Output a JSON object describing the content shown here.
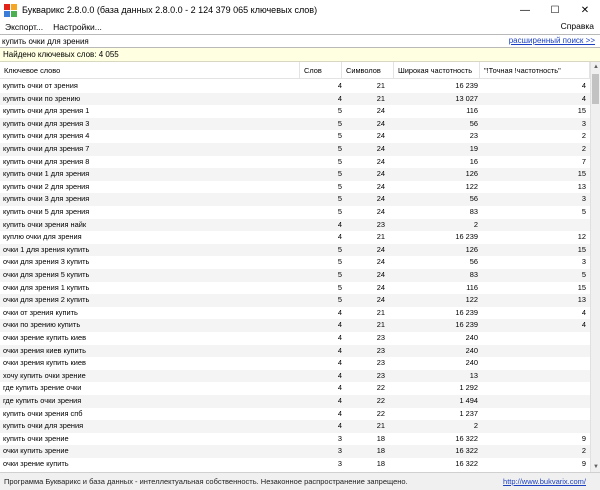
{
  "window": {
    "title": "Букварикс 2.8.0.0 (база данных 2.8.0.0 - 2 124 379 065 ключевых слов)",
    "controls": {
      "minimize": "—",
      "maximize": "☐",
      "close": "✕"
    }
  },
  "menu": {
    "items": [
      "Экспорт...",
      "Настройки..."
    ],
    "help": "Справка"
  },
  "search": {
    "value": "купить очки для зрения",
    "advanced_link": "расширенный поиск >>"
  },
  "found": "Найдено ключевых слов: 4 055",
  "table": {
    "columns": [
      "Ключевое слово",
      "Слов",
      "Символов",
      "Широкая частотность",
      "\"!Точная !частотность\""
    ],
    "rows": [
      [
        "купить очки от зрения",
        "4",
        "21",
        "16 239",
        "4"
      ],
      [
        "купить очки по зрению",
        "4",
        "21",
        "13 027",
        "4"
      ],
      [
        "купить очки для зрения 1",
        "5",
        "24",
        "116",
        "15"
      ],
      [
        "купить очки для зрения 3",
        "5",
        "24",
        "56",
        "3"
      ],
      [
        "купить очки для зрения 4",
        "5",
        "24",
        "23",
        "2"
      ],
      [
        "купить очки для зрения 7",
        "5",
        "24",
        "19",
        "2"
      ],
      [
        "купить очки для зрения 8",
        "5",
        "24",
        "16",
        "7"
      ],
      [
        "купить очки 1 для зрения",
        "5",
        "24",
        "126",
        "15"
      ],
      [
        "купить очки 2 для зрения",
        "5",
        "24",
        "122",
        "13"
      ],
      [
        "купить очки 3 для зрения",
        "5",
        "24",
        "56",
        "3"
      ],
      [
        "купить очки 5 для зрения",
        "5",
        "24",
        "83",
        "5"
      ],
      [
        "купить очки зрения найк",
        "4",
        "23",
        "2",
        ""
      ],
      [
        "куплю очки для зрения",
        "4",
        "21",
        "16 239",
        "12"
      ],
      [
        "очки 1 для зрения купить",
        "5",
        "24",
        "126",
        "15"
      ],
      [
        "очки для зрения 3 купить",
        "5",
        "24",
        "56",
        "3"
      ],
      [
        "очки для зрения 5 купить",
        "5",
        "24",
        "83",
        "5"
      ],
      [
        "очки для зрения 1 купить",
        "5",
        "24",
        "116",
        "15"
      ],
      [
        "очки для зрения 2 купить",
        "5",
        "24",
        "122",
        "13"
      ],
      [
        "очки от зрения купить",
        "4",
        "21",
        "16 239",
        "4"
      ],
      [
        "очки по зрению купить",
        "4",
        "21",
        "16 239",
        "4"
      ],
      [
        "очки зрение купить киев",
        "4",
        "23",
        "240",
        ""
      ],
      [
        "очки зрения киев купить",
        "4",
        "23",
        "240",
        ""
      ],
      [
        "очки зрения купить киев",
        "4",
        "23",
        "240",
        ""
      ],
      [
        "хочу купить очки зрение",
        "4",
        "23",
        "13",
        ""
      ],
      [
        "где купить зрение очки",
        "4",
        "22",
        "1 292",
        ""
      ],
      [
        "где купить очки зрения",
        "4",
        "22",
        "1 494",
        ""
      ],
      [
        "купить очки зрения спб",
        "4",
        "22",
        "1 237",
        ""
      ],
      [
        "купить очки для зрения",
        "4",
        "21",
        "2",
        ""
      ],
      [
        "купить очки зрение",
        "3",
        "18",
        "16 322",
        "9"
      ],
      [
        "очки купить зрение",
        "3",
        "18",
        "16 322",
        "2"
      ],
      [
        "очки зрение купить",
        "3",
        "18",
        "16 322",
        "9"
      ]
    ]
  },
  "status": {
    "text": "Программа Букварикс и база данных - интеллектуальная собственность. Незаконное распространение запрещено.",
    "link": "http://www.bukvarix.com/"
  },
  "colors": {
    "link": "#1a3fc0",
    "found_bg": "#ffffe1",
    "icon_a": "#e2231a",
    "icon_b": "#f5a623",
    "icon_c": "#3b7dd8",
    "icon_d": "#4caf50"
  }
}
